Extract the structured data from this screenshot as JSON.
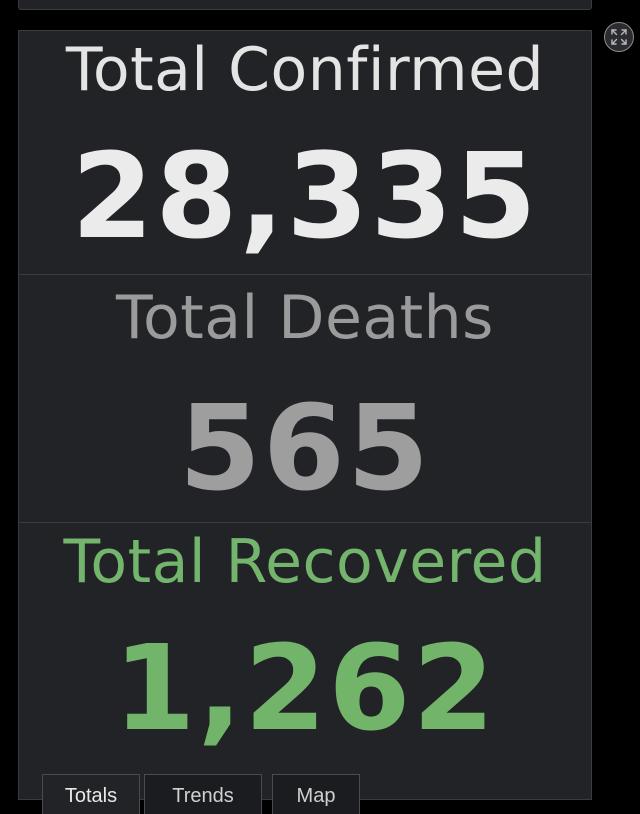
{
  "stats": {
    "confirmed": {
      "label": "Total Confirmed",
      "value": "28,335",
      "color": "#ebebeb"
    },
    "deaths": {
      "label": "Total Deaths",
      "value": "565",
      "color": "#9e9e9e"
    },
    "recovered": {
      "label": "Total Recovered",
      "value": "1,262",
      "color": "#72b56a"
    }
  },
  "controls": {
    "expand_icon": "expand-icon"
  },
  "tabs": [
    {
      "label": "Totals",
      "active": true
    },
    {
      "label": "Trends",
      "active": false
    },
    {
      "label": "Map",
      "active": false
    }
  ],
  "colors": {
    "background": "#000000",
    "panel": "#222327",
    "border": "#3a3b40",
    "accent_green": "#72b56a"
  }
}
